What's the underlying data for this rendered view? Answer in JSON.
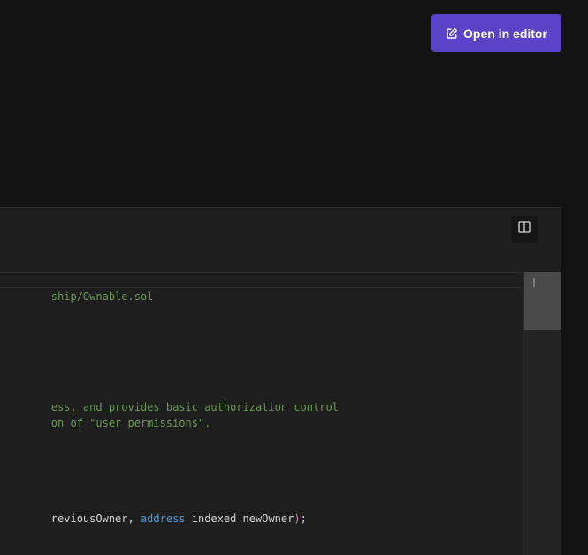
{
  "header": {
    "open_editor_label": "Open in editor",
    "open_editor_icon": "edit-icon",
    "button_color": "#5b43c9"
  },
  "editor": {
    "split_icon": "split-view-icon",
    "lines": [
      {
        "path": "ship/Ownable.sol"
      },
      {
        "comment": "ess, and provides basic authorization control"
      },
      {
        "comment_start": "on of ",
        "string": "\"user permissions\"",
        "comment_end": "."
      },
      {
        "t1": "reviousOwner, ",
        "kw": "address",
        "t2": " indexed newOwner",
        "paren": ")",
        "t3": ";"
      }
    ]
  }
}
